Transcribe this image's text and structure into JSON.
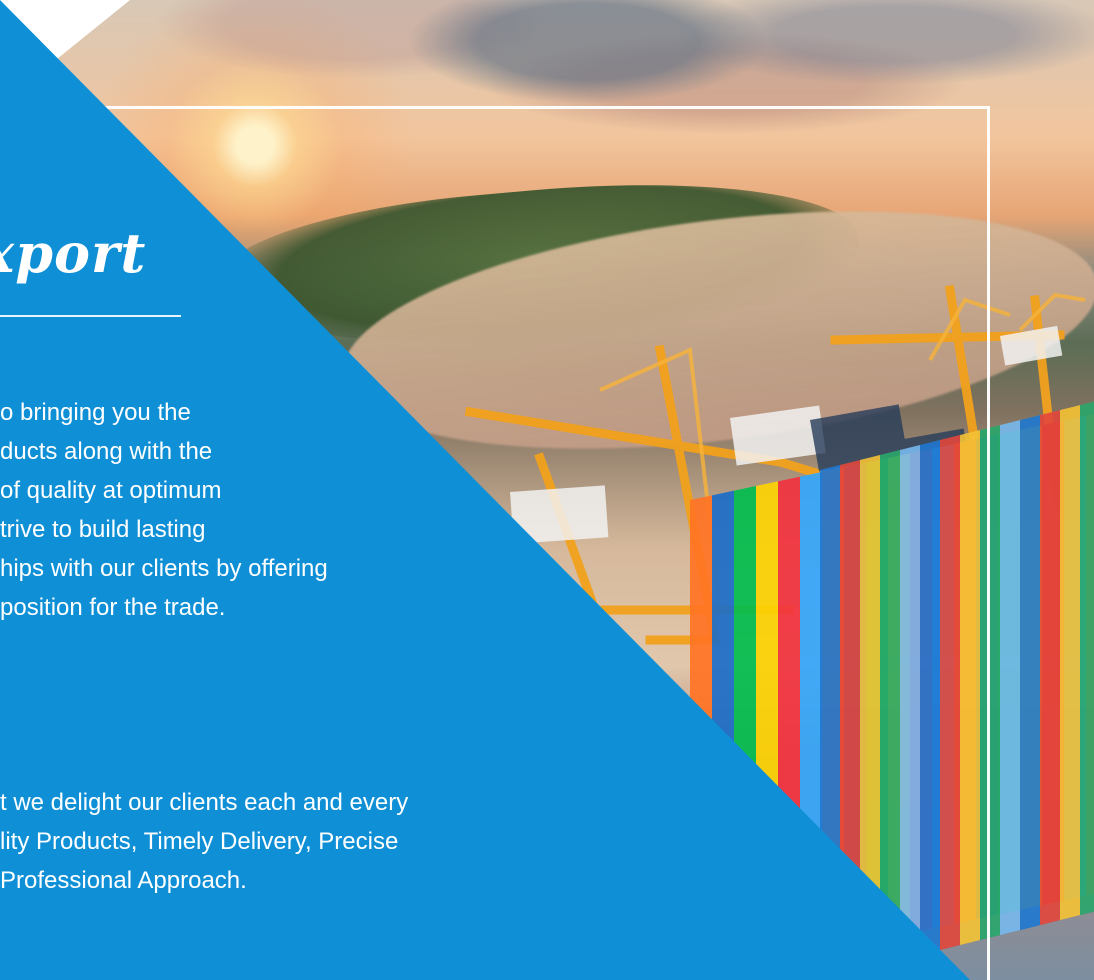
{
  "title": "xport",
  "paragraph1": [
    "o bringing you the",
    "ducts along with the",
    "of quality at optimum",
    "trive to build lasting",
    "hips with our clients by offering",
    "position for the trade."
  ],
  "paragraph2": [
    "t we delight our clients each and every",
    "lity Products, Timely Delivery, Precise",
    " Professional Approach."
  ],
  "colors": {
    "panel": "#0f90d6",
    "frame": "#ffffff",
    "text": "#ffffff"
  }
}
